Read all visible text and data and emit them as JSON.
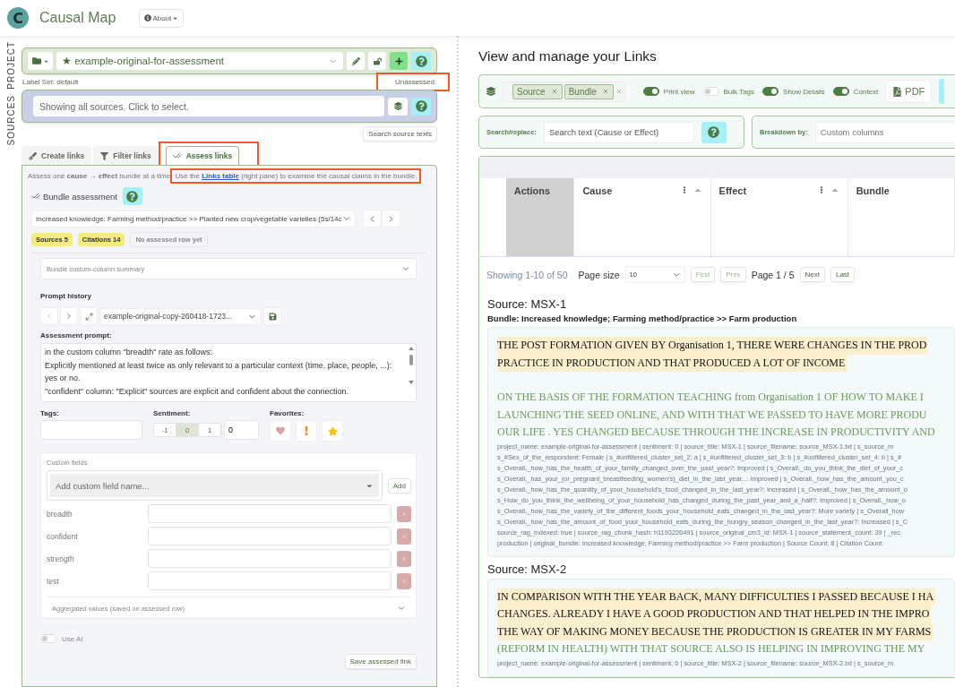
{
  "app": {
    "logo_letter": "C",
    "title": "Causal Map",
    "about": "About"
  },
  "side_labels": [
    "SOURCES",
    "PROJECT"
  ],
  "project": {
    "name": "★ example-original-for-assessment",
    "label_set": "Label Set: default",
    "status": {
      "text": "Unassessed",
      "highlighted": true
    }
  },
  "sources": {
    "placeholder": "Showing all sources. Click to select.",
    "search_button": "Search source texts"
  },
  "tabs": [
    {
      "label": "Create links",
      "kind": "pen",
      "selected": false,
      "highlighted": false
    },
    {
      "label": "Filter links",
      "kind": "filter",
      "selected": false,
      "highlighted": false
    },
    {
      "label": "Assess links",
      "kind": "check",
      "selected": true,
      "highlighted": true
    }
  ],
  "assess": {
    "intro": "Assess one **cause** → **effect** bundle at a time.",
    "instruction": {
      "before": "Use the ",
      "link": "Links table",
      "after": " (right pane) to examine the causal claims in the bundle.",
      "highlighted": true
    },
    "heading": "Bundle assessment",
    "bundle_select": "Increased knowledge: Farming method/practice >> Planted new crop/vegetable varieties (5s/14c",
    "badges": [
      {
        "text": "Sources 5",
        "kind": "count"
      },
      {
        "text": "Citations 14",
        "kind": "count"
      },
      {
        "text": "No assessed row yet",
        "kind": "status"
      }
    ],
    "summary": "Bundle custom-column summary",
    "prompt_history": {
      "label": "Prompt history",
      "value": "example-original-copy-260418-1723...",
      "prev_disabled": true
    },
    "prompt": {
      "label": "Assessment prompt:",
      "text": "in the custom column \"breadth\" rate as follows:\nExplicitly mentioned at least twice as only relevant to a particular context (time, place, people, ...): yes or no.\n\"confident\" column: \"Explicit\" sources are explicit and confident about the connection."
    },
    "tags_label": "Tags:",
    "sentiment": {
      "label": "Sentiment:",
      "options": [
        {
          "label": "-1",
          "selected": false
        },
        {
          "label": "0",
          "selected": true
        },
        {
          "label": "1",
          "selected": false
        }
      ],
      "value": "0"
    },
    "favorites_label": "Favorites:",
    "custom_fields": {
      "title": "Custom fields",
      "placeholder": "Add custom field name...",
      "add": "Add",
      "fields": [
        "breadth",
        "confident",
        "strength",
        "test"
      ],
      "aggregated": "Aggregated values (saved on assessed row)"
    },
    "use_ai": {
      "label": "Use AI",
      "on": false
    },
    "save": "Save assessed link"
  },
  "links": {
    "title": "View and manage your Links",
    "chips": [
      "Source",
      "Bundle"
    ],
    "toggles": [
      {
        "label": "Print view",
        "on": true
      },
      {
        "label": "Bulk Tags",
        "on": false
      },
      {
        "label": "Show Details",
        "on": true
      },
      {
        "label": "Context",
        "on": true
      }
    ],
    "pdf": "PDF",
    "search_label": "Search/replace:",
    "search_placeholder": "Search text (Cause or Effect)",
    "breakdown_label": "Breakdown by:",
    "breakdown_placeholder": "Custom columns",
    "columns": [
      {
        "label": "Actions",
        "kind": "shaded"
      },
      {
        "label": "Cause",
        "kind": "sortable"
      },
      {
        "label": "Effect",
        "kind": "sortable"
      },
      {
        "label": "Bundle",
        "kind": "plain"
      }
    ],
    "pagination": {
      "summary": "Showing 1-10 of 50",
      "page_size_label": "Page size",
      "page_size": "10",
      "page": "Page 1 / 5",
      "buttons": [
        {
          "label": "First",
          "disabled": true
        },
        {
          "label": "Prev",
          "disabled": true
        },
        {
          "label": "Next",
          "disabled": false
        },
        {
          "label": "Last",
          "disabled": false
        }
      ]
    },
    "sources": [
      {
        "title": "Source: MSX-1",
        "bundle": "Bundle: Increased knowledge; Farming method/practice >> Farm production",
        "quote": [
          "THE POST FORMATION GIVEN BY Organisation 1, THERE WERE CHANGES IN THE PROD",
          "PRACTICE IN PRODUCTION AND THAT PRODUCED A LOT OF INCOME"
        ],
        "context": [
          "ON THE BASIS OF THE FORMATION TEACHING from Organisation 1 OF HOW TO MAKE I",
          "LAUNCHING THE SEED ONLINE, AND WITH THAT WE PASSED TO HAVE MORE PRODU",
          "OUR LIFE . YES CHANGED BECAUSE THROUGH THE INCREASE IN PRODUCTIVITY AND"
        ],
        "meta": [
          "project_name: example-original-for-assessment | sentiment: 0 | source_title: MSX-1 | source_filename: source_MSX-1.txt | s_source_m",
          "s_#Sex_of_the_respondent: Female | s_#unfiltered_cluster_set_2: a | s_#unfiltered_cluster_set_3: b | s_#unfiltered_cluster_set_4: b | s_#",
          "s_Overall,_how_has_the_health_of_your_family_changed_over_the_past_year?: Improved | s_Overall,_do_you_think_the_diet_of_your_c",
          "s_Overall,_has_your_(or_pregnant_breastfeeding_women's)_diet_in_the_last_year...: Improved | s_Overall,_how_has_the_amount_you_c",
          "s_Overall,_how_has_the_quantity_of_your_household's_food_changed_in_the_last_year?: Increased | s_Overall,_how_has_the_amount_o",
          "s_How_do_you_think_the_wellbeing_of_your_household_has_changed_during_the_past_year_and_a_half?: Improved | s_Overall,_how_o",
          "s_Overall,_how_has_the_variety_of_the_different_foods_your_household_eats_changed_in_the_last_year?: More variety | s_Overall_how",
          "s_Overall,_how_has_the_amount_of_food_your_household_eats_during_the_hungry_season_changed_in_the_last_year?: Increased | s_C",
          "source_rag_indexed: true | source_rag_chunk_hash: h1193226491 | source_original_cm3_id: MSX-1 | source_statement_count: 39 | _rec",
          "production | original_bundle: Increased knowledge; Farming method/practice >> Farm production | Source Count: 8 | Citation Count:"
        ]
      },
      {
        "title": "Source: MSX-2",
        "quote": [
          "IN COMPARISON WITH THE YEAR BACK, MANY DIFFICULTIES I PASSED BECAUSE I HA",
          "CHANGES. ALREADY I HAVE A GOOD PRODUCTION AND THAT HELPED IN THE IMPRO",
          "THE WAY OF MAKING MONEY BECAUSE THE PRODUCTION IS GREATER IN MY FARMS"
        ],
        "context": [
          "(REFORM IN HEALTH) WITH THAT SOURCE ALSO IS HELPING IN IMPROVING THE MY"
        ],
        "meta": [
          "project_name: example-original-for-assessment | sentiment: 0 | source_title: MSX-2 | source_filename: source_MSX-2.txt | s_source_m"
        ]
      }
    ]
  }
}
